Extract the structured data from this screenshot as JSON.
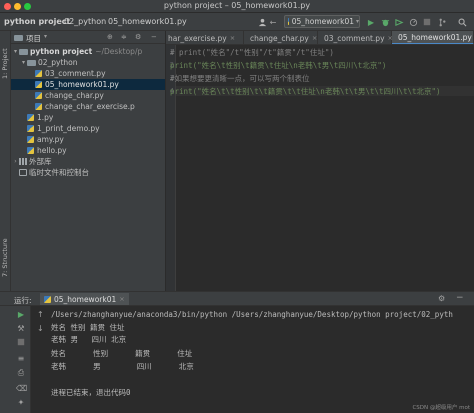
{
  "window": {
    "title": "python project – 05_homework01.py"
  },
  "breadcrumb": {
    "project": "python project",
    "folder": "02_python",
    "file": "05_homework01.py"
  },
  "run_config": {
    "selected": "05_homework01"
  },
  "left_strip": {
    "project_label": "1: Project",
    "structure_label": "7: Structure"
  },
  "project_panel": {
    "title": "项目",
    "tree": [
      {
        "label": "python project",
        "path": "~/Desktop/p",
        "type": "folder",
        "level": 0,
        "expanded": true
      },
      {
        "label": "02_python",
        "type": "folder",
        "level": 1,
        "expanded": true
      },
      {
        "label": "03_comment.py",
        "type": "py",
        "level": 2
      },
      {
        "label": "05_homework01.py",
        "type": "py",
        "level": 2,
        "selected": true
      },
      {
        "label": "change_char.py",
        "type": "py",
        "level": 2
      },
      {
        "label": "change_char_exercise.p",
        "type": "py",
        "level": 2
      },
      {
        "label": "1.py",
        "type": "py",
        "level": 1
      },
      {
        "label": "1_print_demo.py",
        "type": "py",
        "level": 1
      },
      {
        "label": "amy.py",
        "type": "py",
        "level": 1
      },
      {
        "label": "hello.py",
        "type": "py",
        "level": 1
      },
      {
        "label": "外部库",
        "type": "lib",
        "level": 0,
        "expanded": false
      },
      {
        "label": "临时文件和控制台",
        "type": "console",
        "level": 0
      }
    ]
  },
  "editor_tabs": [
    {
      "label": "har_exercise.py",
      "active": false
    },
    {
      "label": "change_char.py",
      "active": false
    },
    {
      "label": "03_comment.py",
      "active": false
    },
    {
      "label": "05_homework01.py",
      "active": true
    }
  ],
  "editor": {
    "line_numbers": [
      "1",
      "2",
      "3",
      "4"
    ],
    "lines": [
      "# print(\"姓名\"/t\"性别\"/t\"籍贯\"/t\"住址\")",
      "print(\"姓名\\t性别\\t籍贯\\t住址\\n老韩\\t男\\t四川\\t北京\")",
      "#如果想要更清晰一点，可以写两个制表位",
      "print(\"姓名\\t\\t性别\\t\\t籍贯\\t\\t住址\\n老韩\\t\\t男\\t\\t四川\\t\\t北京\")"
    ]
  },
  "run_panel": {
    "label": "运行:",
    "tab": "05_homework01",
    "console": [
      "/Users/zhanghanyue/anaconda3/bin/python /Users/zhanghanyue/Desktop/python project/02_pyth",
      "姓名 性别 籍贯 住址",
      "老韩 男   四川 北京",
      "姓名      性别      籍贯      住址",
      "老韩      男        四川      北京",
      "",
      "进程已结束，退出代码0"
    ]
  },
  "watermark": "CSDN @超级用户 mot",
  "colors": {
    "accent": "#4a88c7",
    "selection": "#0d293e",
    "run_green": "#59a869"
  }
}
